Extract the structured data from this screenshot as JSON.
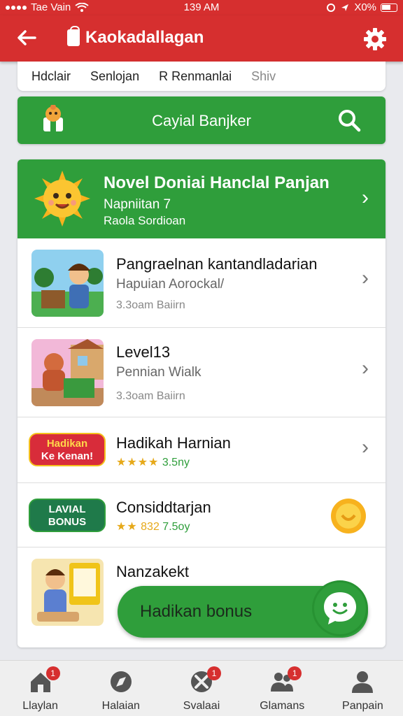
{
  "status_bar": {
    "carrier": "Tae Vain",
    "time": "139 AM",
    "battery": "X0%"
  },
  "app_bar": {
    "back_icon": "arrow-left-icon",
    "title": "Kaokadallagan",
    "settings_icon": "gear-icon"
  },
  "tabs": [
    {
      "label": "Hdclair"
    },
    {
      "label": "Senlojan"
    },
    {
      "label": "R Renmanlai"
    },
    {
      "label": "Shiv"
    }
  ],
  "search": {
    "label": "Cayial Banjker",
    "icon": "search-icon"
  },
  "featured": {
    "title": "Novel Doniai Hanclal Panjan",
    "subtitle": "Napniitan 7",
    "detail": "Raola Sordioan"
  },
  "items": [
    {
      "title": "Pangraelnan kantandladarian",
      "subtitle": "Hapuian Aorockal/",
      "meta": "3.3oam Baiirn"
    },
    {
      "title": "Level13",
      "subtitle": "Pennian Wialk",
      "meta": "3.3oam Baiirn"
    },
    {
      "title": "Hadikah Harnian",
      "badge_line1": "Hadikan",
      "badge_line2": "Ke Kenan!",
      "stars": "★★★★",
      "rating": "3.5ny"
    },
    {
      "title": "Considdtarjan",
      "badge_line1": "LAVIAL",
      "badge_line2": "BONUS",
      "stars": "★★",
      "rating_prefix": "832",
      "rating": "7.5oy"
    },
    {
      "title": "Nanzakekt"
    }
  ],
  "fab": {
    "label": "Hadikan bonus"
  },
  "bottom_nav": [
    {
      "label": "Llaylan",
      "badge": "1"
    },
    {
      "label": "Halaian",
      "badge": ""
    },
    {
      "label": "Svalaai",
      "badge": "1"
    },
    {
      "label": "Glamans",
      "badge": "1"
    },
    {
      "label": "Panpain",
      "badge": ""
    }
  ],
  "colors": {
    "primary_red": "#d62f2f",
    "primary_green": "#2f9e3b",
    "star_yellow": "#e6a91a"
  }
}
